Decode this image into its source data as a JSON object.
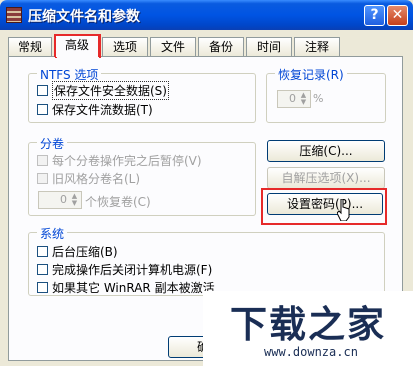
{
  "window": {
    "title": "压缩文件名和参数",
    "help": "?",
    "close": "✕"
  },
  "tabs": [
    "常规",
    "高级",
    "选项",
    "文件",
    "备份",
    "时间",
    "注释"
  ],
  "active_tab": "高级",
  "ntfs": {
    "label": "NTFS 选项",
    "options": [
      "保存文件安全数据(S)",
      "保存文件流数据(T)"
    ]
  },
  "recovery": {
    "label": "恢复记录(R)",
    "value": "0",
    "unit": "%"
  },
  "split": {
    "label": "分卷",
    "options": [
      "每个分卷操作完之后暂停(V)",
      "旧风格分卷名(L)"
    ],
    "spin_value": "0",
    "spin_label": "个恢复卷(C)"
  },
  "buttons": {
    "compress": "压缩(C)...",
    "sfx": "自解压选项(X)...",
    "password": "设置密码(P)...",
    "ok": "确"
  },
  "system": {
    "label": "系统",
    "options": [
      "后台压缩(B)",
      "完成操作后关闭计算机电源(F)",
      "如果其它 WinRAR 副本被激活"
    ]
  },
  "watermark": {
    "title": "下载之家",
    "url": "www.downza.cn"
  },
  "colors": {
    "highlight": "#e62a2a",
    "group_label": "#0046d5",
    "title_bar": "#0054E3"
  }
}
